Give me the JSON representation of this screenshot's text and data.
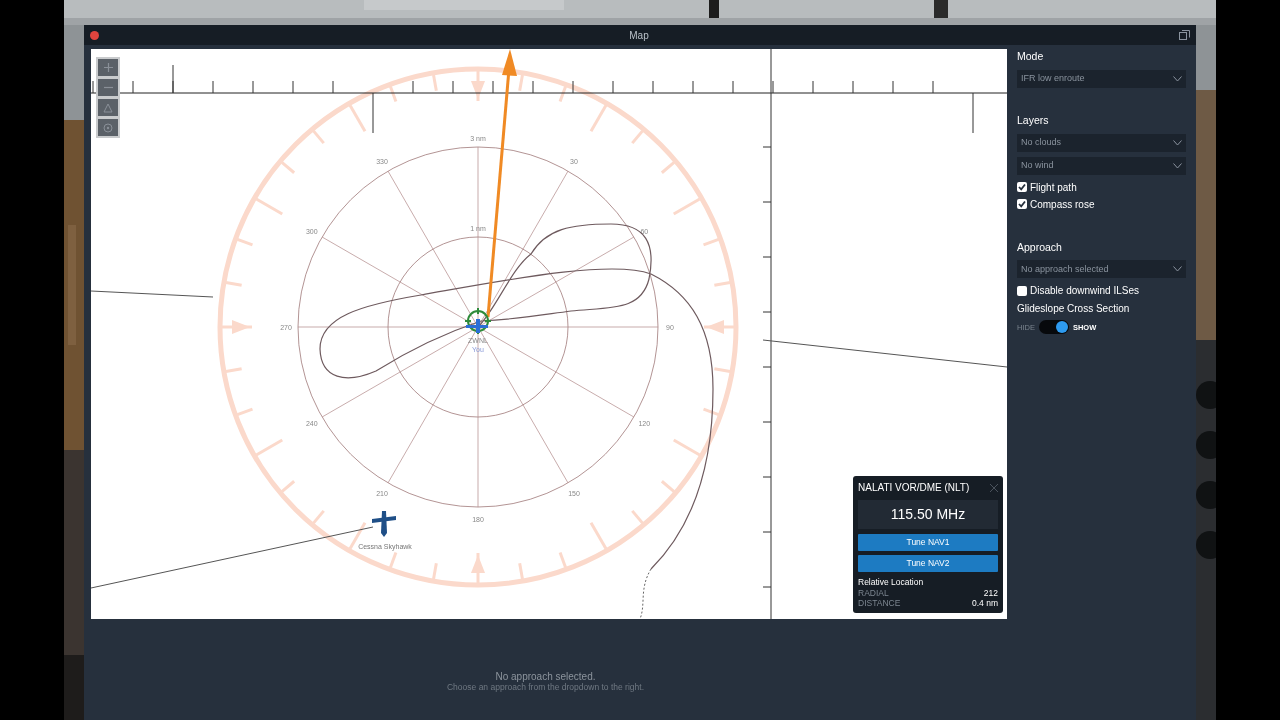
{
  "window": {
    "title": "Map"
  },
  "map": {
    "range_labels": [
      "3 nm",
      "1 nm"
    ],
    "bearing_labels": [
      "30",
      "60",
      "90",
      "120",
      "150",
      "180",
      "210",
      "240",
      "270",
      "300",
      "330"
    ],
    "station_label": "ZWNL",
    "own_label": "You",
    "traffic_label": "Cessna Skyhawk"
  },
  "sidebar": {
    "mode": {
      "label": "Mode",
      "dropdown": "IFR low enroute"
    },
    "layers": {
      "label": "Layers",
      "dropdowns": [
        "No clouds",
        "No wind"
      ],
      "checks": [
        {
          "label": "Flight path",
          "checked": true
        },
        {
          "label": "Compass rose",
          "checked": true
        }
      ]
    },
    "approach": {
      "label": "Approach",
      "dropdown": "No approach selected",
      "checks": [
        {
          "label": "Disable downwind ILSes",
          "checked": false
        }
      ],
      "glideslope": {
        "label": "Glideslope Cross Section",
        "off_label": "HIDE",
        "on_label": "SHOW",
        "on": true
      }
    }
  },
  "popup": {
    "title": "NALATI VOR/DME (NLT)",
    "frequency": "115.50 MHz",
    "buttons": [
      "Tune NAV1",
      "Tune NAV2"
    ],
    "section": "Relative Location",
    "rows": [
      {
        "label": "RADIAL",
        "value": "212"
      },
      {
        "label": "DISTANCE",
        "value": "0.4 nm"
      }
    ]
  },
  "bottom": {
    "message": "No approach selected.",
    "hint": "Choose an approach from the dropdown to the right."
  }
}
